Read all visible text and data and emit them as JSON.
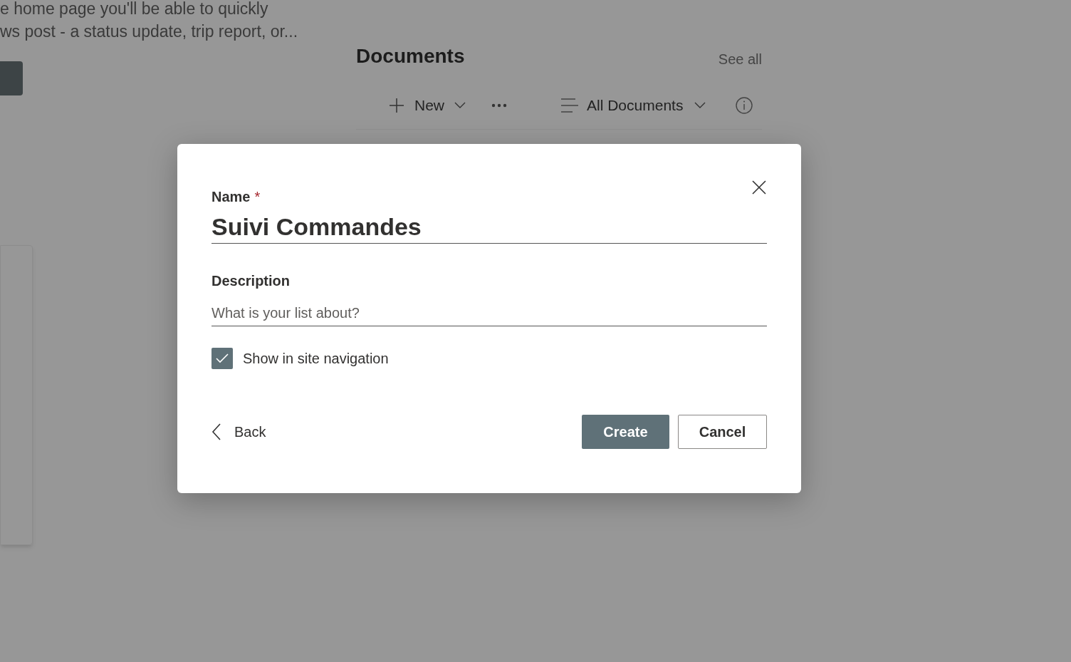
{
  "background_page": {
    "news_text": [
      "e home page you'll be able to quickly",
      "ws post - a status update, trip report, or..."
    ],
    "documents": {
      "title": "Documents",
      "see_all": "See all",
      "new_label": "New",
      "view_label": "All Documents"
    }
  },
  "dialog": {
    "name_label": "Name",
    "required_mark": "*",
    "name_value": "Suivi Commandes",
    "description_label": "Description",
    "description_placeholder": "What is your list about?",
    "show_in_nav": {
      "label": "Show in site navigation",
      "checked": true
    },
    "back": "Back",
    "buttons": [
      {
        "label": "Create",
        "primary": true
      },
      {
        "label": "Cancel",
        "primary": false
      }
    ]
  }
}
